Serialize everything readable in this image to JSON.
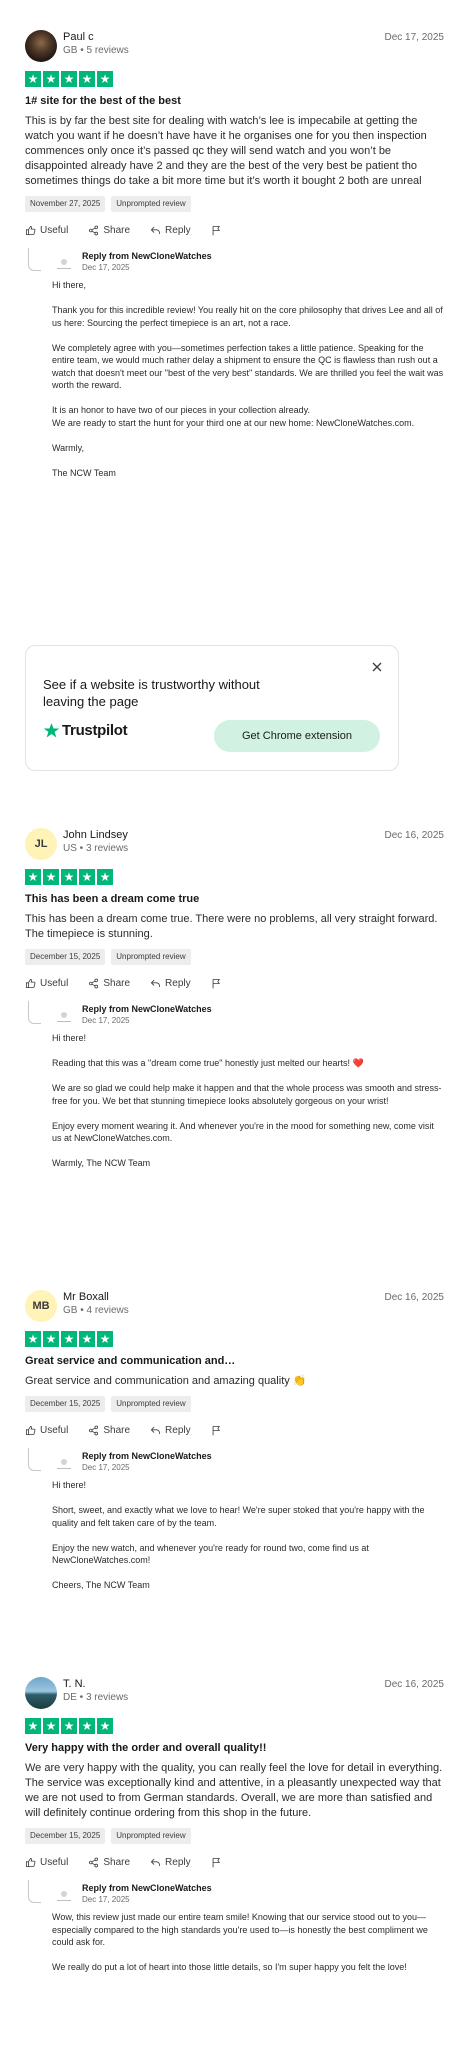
{
  "reviews": [
    {
      "name": "Paul c",
      "sub": "GB • 5 reviews",
      "date": "Dec 17, 2025",
      "avatar_type": "photo-dark",
      "initials": "",
      "rating": 5,
      "title": "1# site for the best of the best",
      "body": "This is by far the best site for dealing with watch’s lee is impecabile at getting the watch you want if he doesn’t have have it he organises one for you then inspection commences only once it’s passed qc they will send watch and you won’t be disappointed already have 2 and they are the best of the very best be patient tho sometimes things do take a bit more time but it’s worth it bought 2 both are unreal",
      "tags": [
        "November 27, 2025",
        "Unprompted review"
      ],
      "reply": {
        "from": "Reply from NewCloneWatches",
        "date": "Dec 17, 2025",
        "paragraphs": [
          "Hi there,",
          "Thank you for this incredible review! You really hit on the core philosophy that drives Lee and all of us here: Sourcing the perfect timepiece is an art, not a race.",
          "We completely agree with you—sometimes perfection takes a little patience. Speaking for the entire team, we would much rather delay a shipment to ensure the QC is flawless than rush out a watch that doesn't meet our \"best of the very best\" standards. We are thrilled you feel the wait was worth the reward.",
          "It is an honor to have two of our pieces in your collection already.\nWe are ready to start the hunt for your third one at our new home: NewCloneWatches.com.",
          "Warmly,",
          "The NCW Team"
        ]
      }
    },
    {
      "name": "John Lindsey",
      "sub": "US • 3 reviews",
      "date": "Dec 16, 2025",
      "avatar_type": "initials",
      "initials": "JL",
      "rating": 5,
      "title": "This has been a dream come true",
      "body": "This has been a dream come true. There were no problems, all very straight forward. The timepiece is stunning.",
      "tags": [
        "December 15, 2025",
        "Unprompted review"
      ],
      "reply": {
        "from": "Reply from NewCloneWatches",
        "date": "Dec 17, 2025",
        "paragraphs": [
          "Hi there!",
          "Reading that this was a \"dream come true\" honestly just melted our hearts! ❤️",
          "We are so glad we could help make it happen and that the whole process was smooth and stress-free for you. We bet that stunning timepiece looks absolutely gorgeous on your wrist!",
          "Enjoy every moment wearing it. And whenever you're in the mood for something new, come visit us at NewCloneWatches.com.",
          "Warmly, The NCW Team"
        ]
      }
    },
    {
      "name": "Mr Boxall",
      "sub": "GB • 4 reviews",
      "date": "Dec 16, 2025",
      "avatar_type": "initials",
      "initials": "MB",
      "rating": 5,
      "title": "Great service and communication and…",
      "body": "Great service and communication and amazing quality 👏",
      "tags": [
        "December 15, 2025",
        "Unprompted review"
      ],
      "reply": {
        "from": "Reply from NewCloneWatches",
        "date": "Dec 17, 2025",
        "paragraphs": [
          "Hi there!",
          "Short, sweet, and exactly what we love to hear! We're super stoked that you're happy with the quality and felt taken care of by the team.",
          "Enjoy the new watch, and whenever you're ready for round two, come find us at NewCloneWatches.com!",
          "Cheers, The NCW Team"
        ]
      }
    },
    {
      "name": "T. N.",
      "sub": "DE • 3 reviews",
      "date": "Dec 16, 2025",
      "avatar_type": "photo-sea",
      "initials": "",
      "rating": 5,
      "title": "Very happy with the order and overall quality!!",
      "body": "We are very happy with the quality, you can really feel the love for detail in everything. The service was exceptionally kind and attentive, in a pleasantly unexpected way that we are not used to from German standards. Overall, we are more than satisfied and will definitely continue ordering from this shop in the future.",
      "tags": [
        "December 15, 2025",
        "Unprompted review"
      ],
      "reply": {
        "from": "Reply from NewCloneWatches",
        "date": "Dec 17, 2025",
        "paragraphs": [
          "Wow, this review just made our entire team smile! Knowing that our service stood out to you—especially compared to the high standards you're used to—is honestly the best compliment we could ask for.",
          "We really do put a lot of heart into those little details, so I'm super happy you felt the love!"
        ]
      }
    }
  ],
  "actions": {
    "useful": "Useful",
    "share": "Share",
    "reply": "Reply"
  },
  "promo": {
    "text": "See if a website is trustworthy without leaving the page",
    "logo": "Trustpilot",
    "button": "Get Chrome extension"
  },
  "colors": {
    "star_green": "#00b67a",
    "promo_button": "#d1f2e2",
    "tag_bg": "#ededed"
  }
}
